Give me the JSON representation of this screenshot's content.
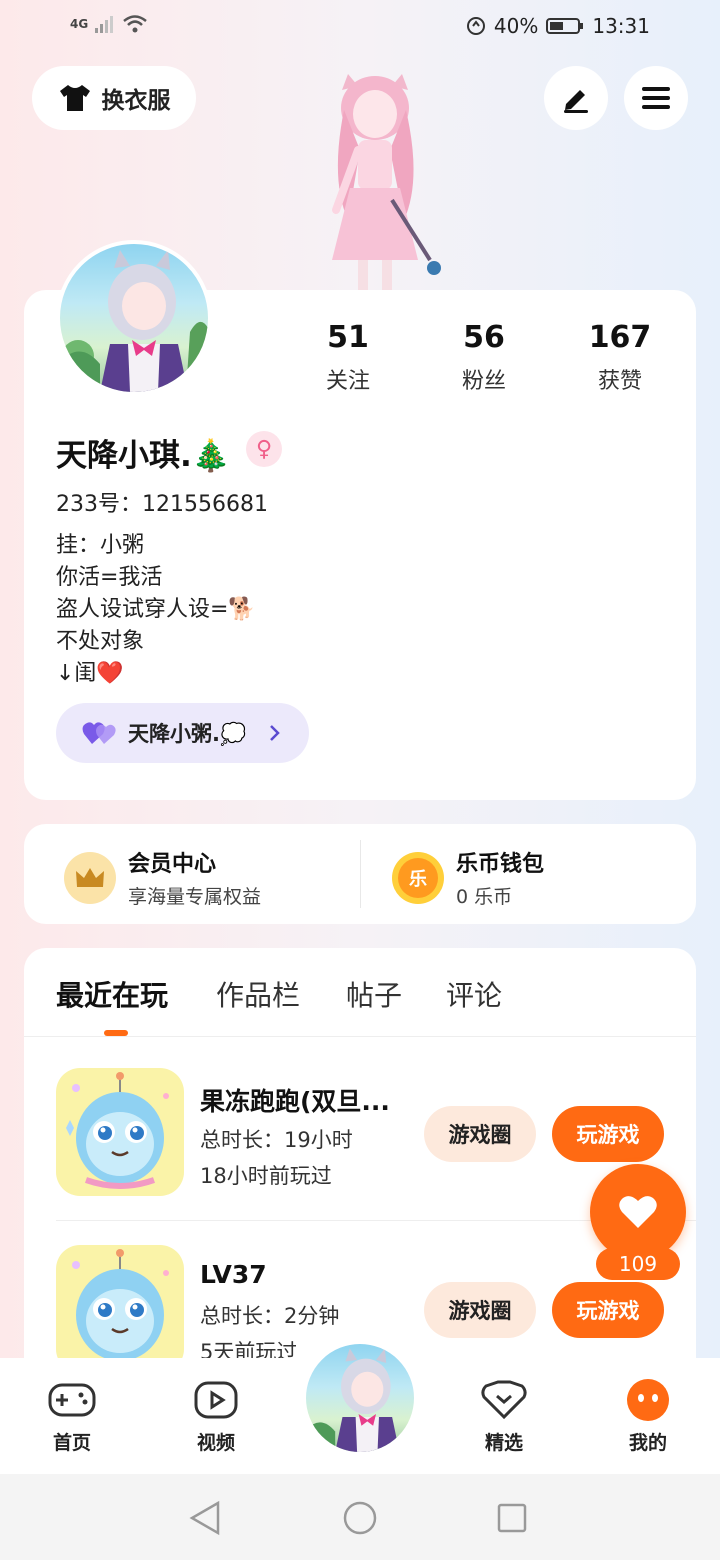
{
  "status_bar": {
    "network": "4G",
    "battery": "40%",
    "time": "13:31"
  },
  "header": {
    "outfit_label": "换衣服"
  },
  "profile": {
    "stats": [
      {
        "num": "51",
        "label": "关注"
      },
      {
        "num": "56",
        "label": "粉丝"
      },
      {
        "num": "167",
        "label": "获赞"
      }
    ],
    "name": "天降小琪.🎄",
    "gender_symbol": "♀",
    "uid": "233号：121556681",
    "bio": [
      "挂：小粥",
      "你活=我活",
      "盗人设试穿人设=🐕",
      "不处对象",
      "↓闺❤️"
    ],
    "cp_label": "天降小粥.💭"
  },
  "wallet": {
    "vip_title": "会员中心",
    "vip_sub": "享海量专属权益",
    "coin_title": "乐币钱包",
    "coin_sub": "0 乐币",
    "coin_icon_text": "乐"
  },
  "tabs": [
    {
      "label": "最近在玩"
    },
    {
      "label": "作品栏"
    },
    {
      "label": "帖子"
    },
    {
      "label": "评论"
    }
  ],
  "games": [
    {
      "title": "果冻跑跑(双旦...",
      "duration": "总时长：19小时",
      "last": "18小时前玩过",
      "circle_label": "游戏圈",
      "play_label": "玩游戏"
    },
    {
      "title": "LV37",
      "duration": "总时长：2分钟",
      "last": "5天前玩过",
      "circle_label": "游戏圈",
      "play_label": "玩游戏"
    }
  ],
  "like": {
    "count": "109"
  },
  "bottom_nav": [
    {
      "label": "首页"
    },
    {
      "label": "视频"
    },
    {
      "label": "精选"
    },
    {
      "label": "我的"
    }
  ]
}
